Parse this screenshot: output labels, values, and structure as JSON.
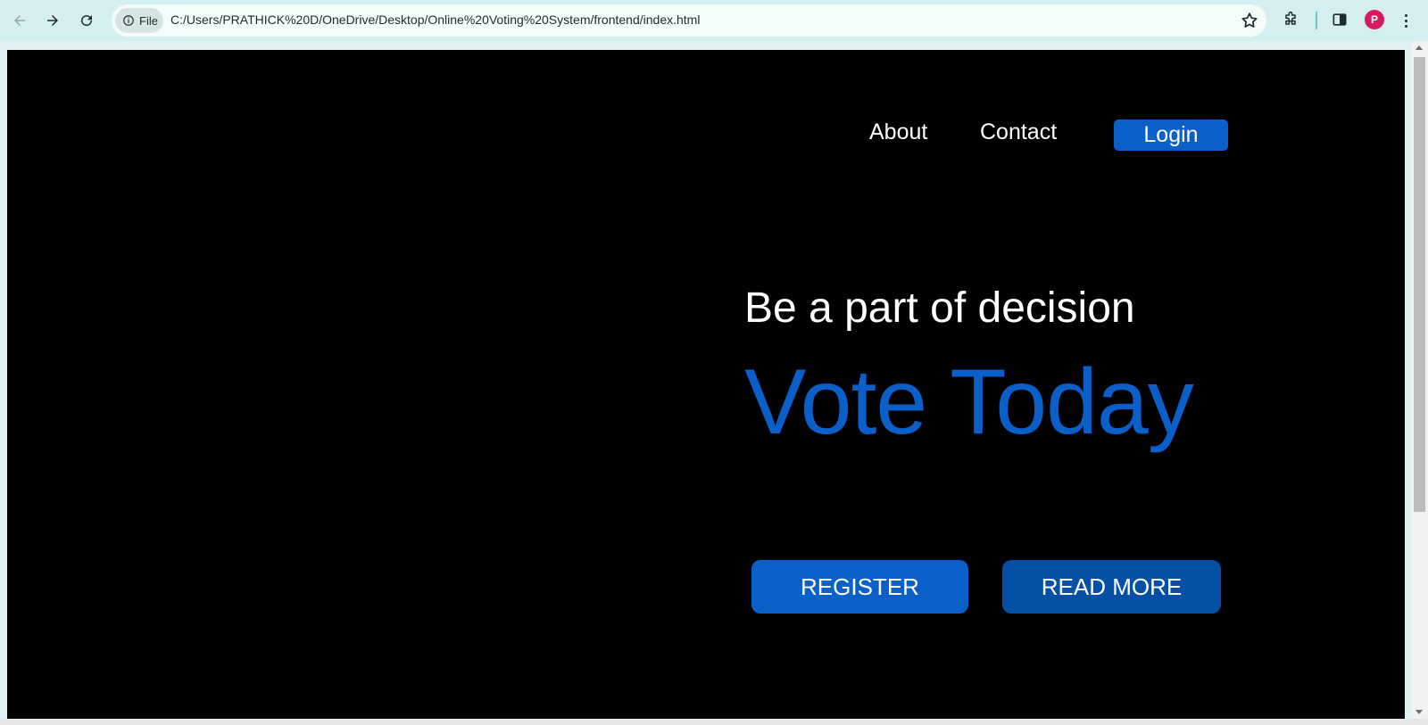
{
  "browser": {
    "site_info_label": "File",
    "url": "C:/Users/PRATHICK%20D/OneDrive/Desktop/Online%20Voting%20System/frontend/index.html",
    "profile_initial": "P"
  },
  "nav": {
    "about": "About",
    "contact": "Contact",
    "login": "Login"
  },
  "hero": {
    "tagline": "Be a part of decision",
    "headline": "Vote Today"
  },
  "cta": {
    "register": "REGISTER",
    "read_more": "READ MORE"
  },
  "colors": {
    "accent": "#0a5fc8",
    "accent_dark": "#0550a6",
    "background": "#000000",
    "toolbar": "#d5eef0"
  }
}
